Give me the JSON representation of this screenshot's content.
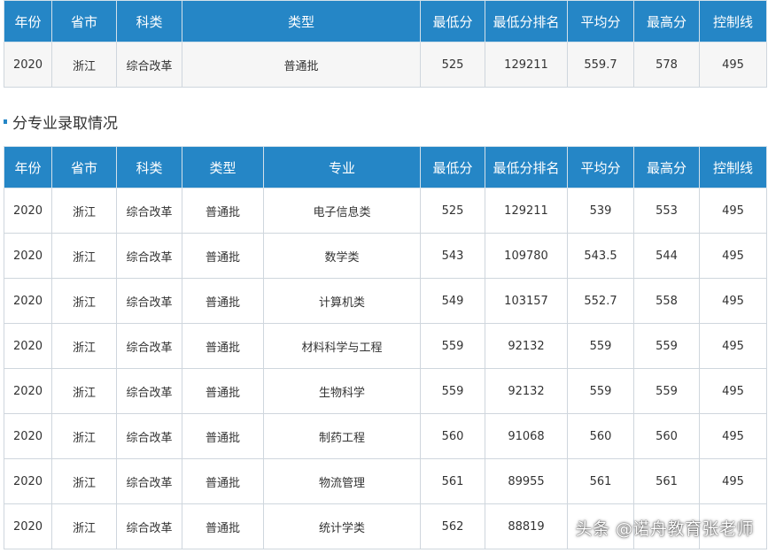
{
  "summary_table": {
    "headers": [
      "年份",
      "省市",
      "科类",
      "类型",
      "最低分",
      "最低分排名",
      "平均分",
      "最高分",
      "控制线"
    ],
    "rows": [
      [
        "2020",
        "浙江",
        "综合改革",
        "普通批",
        "525",
        "129211",
        "559.7",
        "578",
        "495"
      ]
    ]
  },
  "section": {
    "title": "分专业录取情况"
  },
  "major_table": {
    "headers": [
      "年份",
      "省市",
      "科类",
      "类型",
      "专业",
      "最低分",
      "最低分排名",
      "平均分",
      "最高分",
      "控制线"
    ],
    "rows": [
      [
        "2020",
        "浙江",
        "综合改革",
        "普通批",
        "电子信息类",
        "525",
        "129211",
        "539",
        "553",
        "495"
      ],
      [
        "2020",
        "浙江",
        "综合改革",
        "普通批",
        "数学类",
        "543",
        "109780",
        "543.5",
        "544",
        "495"
      ],
      [
        "2020",
        "浙江",
        "综合改革",
        "普通批",
        "计算机类",
        "549",
        "103157",
        "552.7",
        "558",
        "495"
      ],
      [
        "2020",
        "浙江",
        "综合改革",
        "普通批",
        "材料科学与工程",
        "559",
        "92132",
        "559",
        "559",
        "495"
      ],
      [
        "2020",
        "浙江",
        "综合改革",
        "普通批",
        "生物科学",
        "559",
        "92132",
        "559",
        "559",
        "495"
      ],
      [
        "2020",
        "浙江",
        "综合改革",
        "普通批",
        "制药工程",
        "560",
        "91068",
        "560",
        "560",
        "495"
      ],
      [
        "2020",
        "浙江",
        "综合改革",
        "普通批",
        "物流管理",
        "561",
        "89955",
        "561",
        "561",
        "495"
      ],
      [
        "2020",
        "浙江",
        "综合改革",
        "普通批",
        "统计学类",
        "562",
        "88819",
        "",
        "",
        ""
      ]
    ]
  },
  "watermark": "头条 @诺舟教育张老师",
  "colors": {
    "header_bg": "#2586c6",
    "header_text": "#ffffff",
    "summary_row_bg": "#f6f6f6"
  }
}
